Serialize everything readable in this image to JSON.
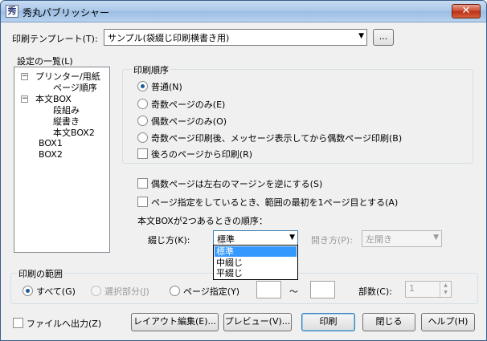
{
  "window": {
    "title": "秀丸パブリッシャー",
    "close_label": "✕"
  },
  "template": {
    "label": "印刷テンプレート(T):",
    "value": "サンプル(袋綴じ印刷横書き用)",
    "browse_label": "..."
  },
  "settings_list": {
    "label": "設定の一覧(L)",
    "items": [
      {
        "label": "プリンター/用紙",
        "expander": "−"
      },
      {
        "label": "ページ順序"
      },
      {
        "label": "本文BOX",
        "expander": "−"
      },
      {
        "label": "段組み"
      },
      {
        "label": "縦書き"
      },
      {
        "label": "本文BOX2"
      },
      {
        "label": "BOX1"
      },
      {
        "label": "BOX2"
      }
    ]
  },
  "print_order": {
    "group_label": "印刷順序",
    "options": [
      {
        "label": "普通(N)",
        "checked": true
      },
      {
        "label": "奇数ページのみ(E)",
        "checked": false
      },
      {
        "label": "偶数ページのみ(O)",
        "checked": false
      },
      {
        "label": "奇数ページ印刷後、メッセージ表示してから偶数ページ印刷(B)",
        "checked": false
      }
    ],
    "reverse_label": "後ろのページから印刷(R)"
  },
  "options": {
    "swap_margin_label": "偶数ページは左右のマージンを逆にする(S)",
    "first_page_label": "ページ指定をしているとき、範囲の最初を1ページ目とする(A)",
    "box_order_label": "本文BOXが2つあるときの順序："
  },
  "binding": {
    "label": "綴じ方(K):",
    "value": "標準",
    "options": [
      "標準",
      "中綴じ",
      "平綴じ"
    ]
  },
  "opening": {
    "label": "開き方(P):",
    "value": "左開き"
  },
  "range": {
    "group_label": "印刷の範囲",
    "all_label": "すべて(G)",
    "selection_label": "選択部分(J)",
    "pages_label": "ページ指定(Y)",
    "tilde": "～",
    "copies_label": "部数(C):",
    "copies_value": "1"
  },
  "file_output_label": "ファイルへ出力(Z)",
  "buttons": {
    "layout": "レイアウト編集(E)...",
    "preview": "プレビュー(V)...",
    "print": "印刷",
    "close": "閉じる",
    "help": "ヘルプ(H)"
  }
}
